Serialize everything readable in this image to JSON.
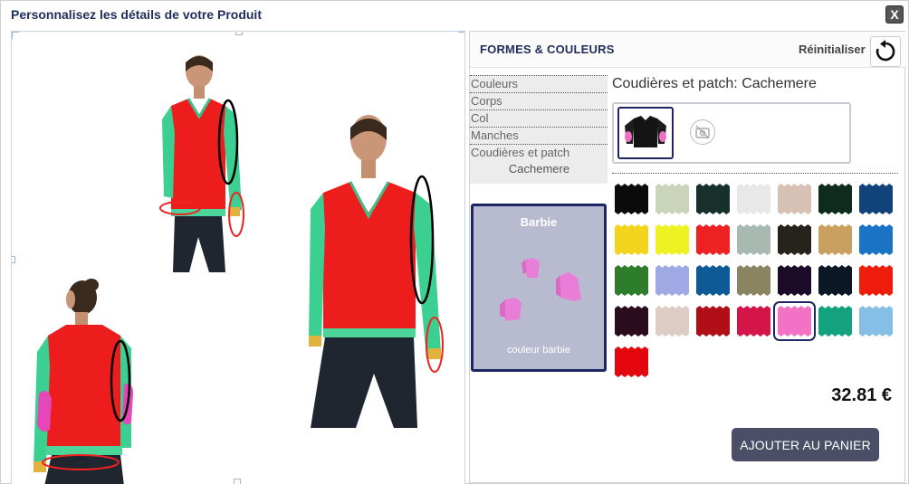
{
  "dialog": {
    "title": "Personnalisez les détails de votre Produit",
    "close_label": "X"
  },
  "panel": {
    "title": "FORMES & COULEURS",
    "reset_label": "Réinitialiser",
    "menu": [
      {
        "label": "Couleurs"
      },
      {
        "label": "Corps"
      },
      {
        "label": "Col"
      },
      {
        "label": "Manches"
      },
      {
        "label": "Coudières et patch",
        "sub": "Cachemere"
      }
    ],
    "section_title": "Coudières et patch: Cachemere",
    "barbie": {
      "title": "Barbie",
      "caption": "couleur barbie"
    },
    "swatches": [
      {
        "color": "#0b0b0b"
      },
      {
        "color": "#c9d4b8"
      },
      {
        "color": "#17302c"
      },
      {
        "color": "#e8e8e8"
      },
      {
        "color": "#d7c1b4"
      },
      {
        "color": "#0f2b1d"
      },
      {
        "color": "#10437a"
      },
      {
        "color": "#f2d41c"
      },
      {
        "color": "#eef223"
      },
      {
        "color": "#ee2222"
      },
      {
        "color": "#a8b9b2"
      },
      {
        "color": "#25231b"
      },
      {
        "color": "#c9a05f"
      },
      {
        "color": "#1a73c4"
      },
      {
        "color": "#2e7d2b"
      },
      {
        "color": "#9fa9e4"
      },
      {
        "color": "#0e5a96"
      },
      {
        "color": "#8a8560"
      },
      {
        "color": "#1c0a29"
      },
      {
        "color": "#0a1725"
      },
      {
        "color": "#ee1c0a"
      },
      {
        "color": "#2a0c1c"
      },
      {
        "color": "#ddccc4"
      },
      {
        "color": "#b10f17"
      },
      {
        "color": "#d4154a"
      },
      {
        "color": "#f472c5",
        "selected": true
      },
      {
        "color": "#12a37e"
      },
      {
        "color": "#86bfe6"
      },
      {
        "color": "#e3060d"
      }
    ],
    "price": "32.81 €",
    "add_to_cart": "AJOUTER AU PANIER"
  }
}
